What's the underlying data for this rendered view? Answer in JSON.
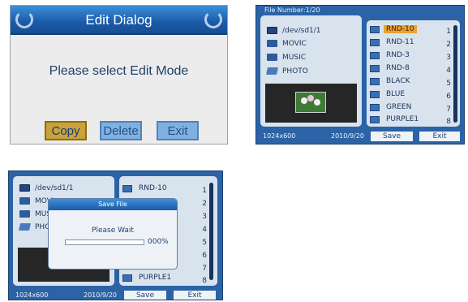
{
  "edit_dialog": {
    "title": "Edit Dialog",
    "prompt": "Please select Edit Mode",
    "buttons": {
      "copy": "Copy",
      "delete": "Delete",
      "exit": "Exit"
    },
    "selected": "Copy"
  },
  "browser": {
    "file_number_label": "File Number:1/20",
    "folders": [
      "/dev/sd1/1",
      "MOVIC",
      "MUSIC",
      "PHOTO"
    ],
    "files": [
      {
        "name": "RND-10",
        "num": "1",
        "selected": true
      },
      {
        "name": "RND-11",
        "num": "2"
      },
      {
        "name": "RND-3",
        "num": "3"
      },
      {
        "name": "RND-8",
        "num": "4"
      },
      {
        "name": "BLACK",
        "num": "5"
      },
      {
        "name": "BLUE",
        "num": "6"
      },
      {
        "name": "GREEN",
        "num": "7"
      },
      {
        "name": "PURPLE1",
        "num": "8"
      }
    ],
    "resolution": "1024x600",
    "date": "2010/9/20",
    "save_label": "Save",
    "exit_label": "Exit"
  },
  "save_dialog_screen": {
    "folders": [
      "/dev/sd1/1",
      "MOVI",
      "MUS",
      "PHO"
    ],
    "files": [
      {
        "name": "RND-10",
        "num": "1"
      },
      {
        "name": "PURPLE1",
        "num": "8"
      }
    ],
    "numbers": [
      "1",
      "2",
      "3",
      "4",
      "5",
      "6",
      "7",
      "8"
    ],
    "resolution": "1024x600",
    "date": "2010/9/20",
    "save_label": "Save",
    "exit_label": "Exit",
    "dialog": {
      "title": "Save File",
      "message": "Please Wait",
      "progress_text": "000%",
      "progress": 0
    }
  },
  "colors": {
    "title_blue": "#1a5aa8",
    "browser_blue": "#2b63a6",
    "selected_orange": "#e7a42f",
    "copy_gold": "#c9a23a"
  }
}
